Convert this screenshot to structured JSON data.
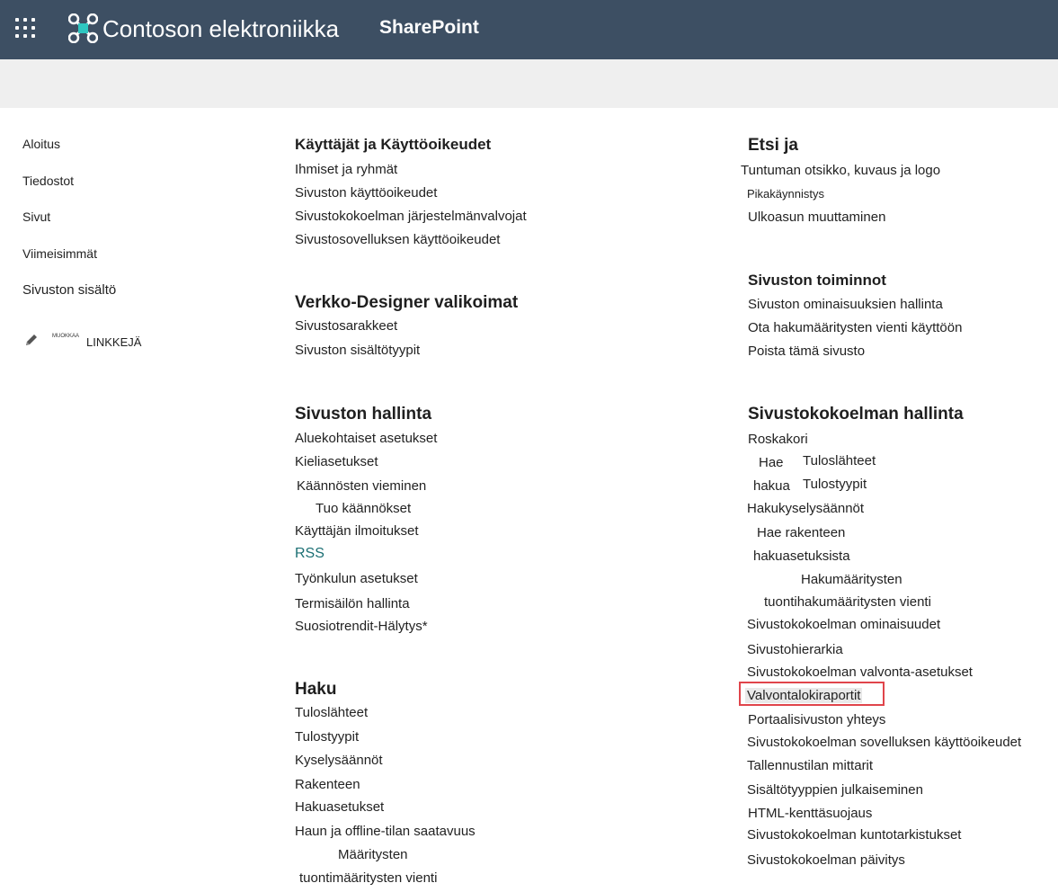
{
  "header": {
    "brand": "Contoson elektroniikka",
    "product": "SharePoint",
    "colors": {
      "suite_bar": "#3d4f63",
      "logo_accent": "#2ec6c0",
      "highlight": "#e0454b",
      "rss": "#1b6f73"
    }
  },
  "nav": {
    "items": [
      "Aloitus",
      "Tiedostot",
      "Sivut",
      "Viimeisimmät",
      "Sivuston sisältö"
    ],
    "edit_small": "MUOKKAA",
    "edit_big": "LINKKEJÄ"
  },
  "users": {
    "title": "Käyttäjät ja  Käyttöoikeudet",
    "links": [
      "Ihmiset ja ryhmät",
      "Sivuston käyttöoikeudet",
      "Sivustokokoelman järjestelmänvalvojat",
      "Sivustosovelluksen käyttöoikeudet"
    ]
  },
  "designer": {
    "title": "Verkko-Designer valikoimat",
    "links": [
      "Sivustosarakkeet",
      "Sivuston sisältötyypit"
    ]
  },
  "admin": {
    "title": "Sivuston hallinta",
    "links": [
      "Aluekohtaiset asetukset",
      "Kieliasetukset",
      "Käännösten vieminen",
      "Tuo käännökset",
      "Käyttäjän ilmoitukset",
      "RSS",
      "Työnkulun asetukset",
      "Termisäilön hallinta",
      "Suosiotrendit-Hälytys*"
    ]
  },
  "search": {
    "title": "Haku",
    "links": [
      "Tuloslähteet",
      "Tulostyypit",
      "Kyselysäännöt",
      "Rakenteen",
      "Hakuasetukset",
      "Haun ja offline-tilan saatavuus",
      "Määritysten",
      "tuontimääritysten vienti"
    ]
  },
  "look": {
    "title": "Etsi ja",
    "links": [
      "Tuntuman otsikko, kuvaus ja logo",
      "Pikakäynnistys",
      "Ulkoasun muuttaminen"
    ]
  },
  "actions": {
    "title": "Sivuston toiminnot",
    "links": [
      "Sivuston ominaisuuksien hallinta",
      "Ota hakumääritysten vienti käyttöön",
      "Poista tämä sivusto"
    ]
  },
  "collection": {
    "title": "Sivustokokoelman hallinta",
    "links": [
      "Roskakori",
      "Hae",
      "Tuloslähteet",
      "hakua",
      "Tulostyypit",
      "Hakukyselysäännöt",
      "Hae rakenteen",
      "hakuasetuksista",
      "Hakumääritysten",
      "tuontihakumääritysten vienti",
      "Sivustokokoelman ominaisuudet",
      "Sivustohierarkia",
      "Sivustokokoelman valvonta-asetukset",
      "Valvontalokiraportit",
      "Portaalisivuston yhteys",
      "Sivustokokoelman sovelluksen käyttöoikeudet",
      "Tallennustilan mittarit",
      "Sisältötyyppien julkaiseminen",
      "HTML-kenttäsuojaus",
      "Sivustokokoelman kuntotarkistukset",
      "Sivustokokoelman päivitys"
    ]
  }
}
